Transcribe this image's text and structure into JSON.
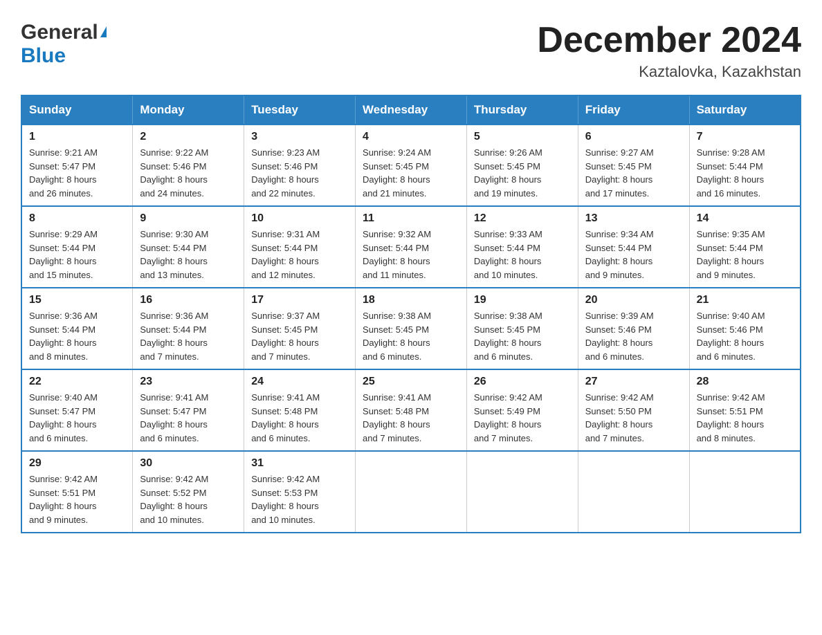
{
  "header": {
    "logo_general": "General",
    "logo_blue": "Blue",
    "title": "December 2024",
    "subtitle": "Kaztalovka, Kazakhstan"
  },
  "weekdays": [
    "Sunday",
    "Monday",
    "Tuesday",
    "Wednesday",
    "Thursday",
    "Friday",
    "Saturday"
  ],
  "weeks": [
    [
      {
        "day": "1",
        "sunrise": "9:21 AM",
        "sunset": "5:47 PM",
        "daylight": "8 hours and 26 minutes."
      },
      {
        "day": "2",
        "sunrise": "9:22 AM",
        "sunset": "5:46 PM",
        "daylight": "8 hours and 24 minutes."
      },
      {
        "day": "3",
        "sunrise": "9:23 AM",
        "sunset": "5:46 PM",
        "daylight": "8 hours and 22 minutes."
      },
      {
        "day": "4",
        "sunrise": "9:24 AM",
        "sunset": "5:45 PM",
        "daylight": "8 hours and 21 minutes."
      },
      {
        "day": "5",
        "sunrise": "9:26 AM",
        "sunset": "5:45 PM",
        "daylight": "8 hours and 19 minutes."
      },
      {
        "day": "6",
        "sunrise": "9:27 AM",
        "sunset": "5:45 PM",
        "daylight": "8 hours and 17 minutes."
      },
      {
        "day": "7",
        "sunrise": "9:28 AM",
        "sunset": "5:44 PM",
        "daylight": "8 hours and 16 minutes."
      }
    ],
    [
      {
        "day": "8",
        "sunrise": "9:29 AM",
        "sunset": "5:44 PM",
        "daylight": "8 hours and 15 minutes."
      },
      {
        "day": "9",
        "sunrise": "9:30 AM",
        "sunset": "5:44 PM",
        "daylight": "8 hours and 13 minutes."
      },
      {
        "day": "10",
        "sunrise": "9:31 AM",
        "sunset": "5:44 PM",
        "daylight": "8 hours and 12 minutes."
      },
      {
        "day": "11",
        "sunrise": "9:32 AM",
        "sunset": "5:44 PM",
        "daylight": "8 hours and 11 minutes."
      },
      {
        "day": "12",
        "sunrise": "9:33 AM",
        "sunset": "5:44 PM",
        "daylight": "8 hours and 10 minutes."
      },
      {
        "day": "13",
        "sunrise": "9:34 AM",
        "sunset": "5:44 PM",
        "daylight": "8 hours and 9 minutes."
      },
      {
        "day": "14",
        "sunrise": "9:35 AM",
        "sunset": "5:44 PM",
        "daylight": "8 hours and 9 minutes."
      }
    ],
    [
      {
        "day": "15",
        "sunrise": "9:36 AM",
        "sunset": "5:44 PM",
        "daylight": "8 hours and 8 minutes."
      },
      {
        "day": "16",
        "sunrise": "9:36 AM",
        "sunset": "5:44 PM",
        "daylight": "8 hours and 7 minutes."
      },
      {
        "day": "17",
        "sunrise": "9:37 AM",
        "sunset": "5:45 PM",
        "daylight": "8 hours and 7 minutes."
      },
      {
        "day": "18",
        "sunrise": "9:38 AM",
        "sunset": "5:45 PM",
        "daylight": "8 hours and 6 minutes."
      },
      {
        "day": "19",
        "sunrise": "9:38 AM",
        "sunset": "5:45 PM",
        "daylight": "8 hours and 6 minutes."
      },
      {
        "day": "20",
        "sunrise": "9:39 AM",
        "sunset": "5:46 PM",
        "daylight": "8 hours and 6 minutes."
      },
      {
        "day": "21",
        "sunrise": "9:40 AM",
        "sunset": "5:46 PM",
        "daylight": "8 hours and 6 minutes."
      }
    ],
    [
      {
        "day": "22",
        "sunrise": "9:40 AM",
        "sunset": "5:47 PM",
        "daylight": "8 hours and 6 minutes."
      },
      {
        "day": "23",
        "sunrise": "9:41 AM",
        "sunset": "5:47 PM",
        "daylight": "8 hours and 6 minutes."
      },
      {
        "day": "24",
        "sunrise": "9:41 AM",
        "sunset": "5:48 PM",
        "daylight": "8 hours and 6 minutes."
      },
      {
        "day": "25",
        "sunrise": "9:41 AM",
        "sunset": "5:48 PM",
        "daylight": "8 hours and 7 minutes."
      },
      {
        "day": "26",
        "sunrise": "9:42 AM",
        "sunset": "5:49 PM",
        "daylight": "8 hours and 7 minutes."
      },
      {
        "day": "27",
        "sunrise": "9:42 AM",
        "sunset": "5:50 PM",
        "daylight": "8 hours and 7 minutes."
      },
      {
        "day": "28",
        "sunrise": "9:42 AM",
        "sunset": "5:51 PM",
        "daylight": "8 hours and 8 minutes."
      }
    ],
    [
      {
        "day": "29",
        "sunrise": "9:42 AM",
        "sunset": "5:51 PM",
        "daylight": "8 hours and 9 minutes."
      },
      {
        "day": "30",
        "sunrise": "9:42 AM",
        "sunset": "5:52 PM",
        "daylight": "8 hours and 10 minutes."
      },
      {
        "day": "31",
        "sunrise": "9:42 AM",
        "sunset": "5:53 PM",
        "daylight": "8 hours and 10 minutes."
      },
      null,
      null,
      null,
      null
    ]
  ],
  "labels": {
    "sunrise": "Sunrise:",
    "sunset": "Sunset:",
    "daylight": "Daylight:"
  }
}
